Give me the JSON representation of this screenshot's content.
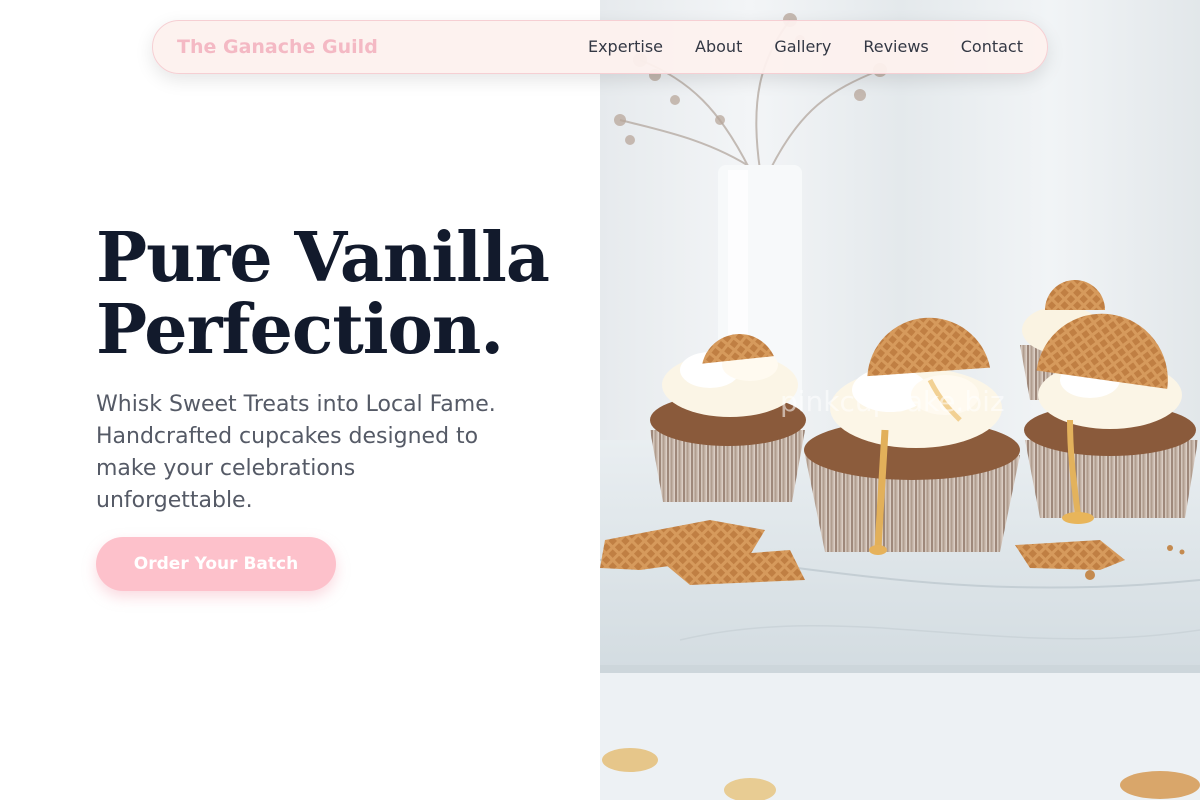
{
  "nav": {
    "brand": "The Ganache Guild",
    "links": [
      "Expertise",
      "About",
      "Gallery",
      "Reviews",
      "Contact"
    ]
  },
  "hero": {
    "headline_line1": "Pure Vanilla",
    "headline_line2": "Perfection.",
    "subtitle": "Whisk Sweet Treats into Local Fame. Handcrafted cupcakes designed to make your celebrations unforgettable.",
    "cta_label": "Order Your Batch"
  },
  "photo": {
    "watermark": "pinkcupcake.biz",
    "subject": "vanilla cupcakes with cream frosting and waffle cookie toppers on marble"
  },
  "colors": {
    "brand_pink": "#f4b9c4",
    "cta_pink": "#fdc1cb",
    "headline": "#121a2c",
    "body_text": "#555a66",
    "nav_bg": "#fdf1ee"
  }
}
